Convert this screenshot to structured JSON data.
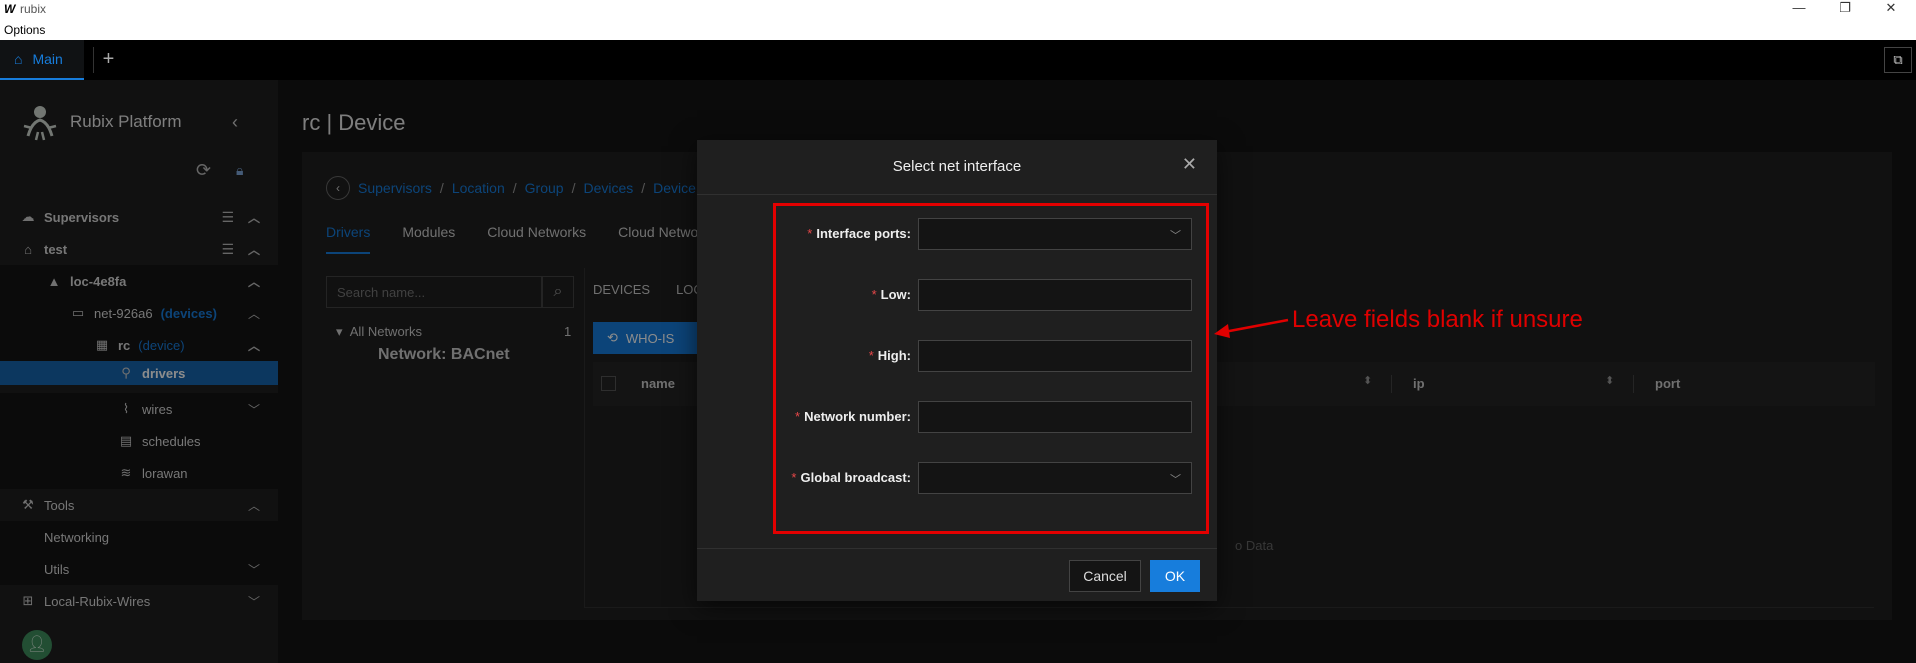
{
  "window": {
    "logo": "W",
    "title": "rubix",
    "minimize": "—",
    "restore": "❐",
    "close": "✕"
  },
  "menu": {
    "options": "Options"
  },
  "tabs": {
    "main": "Main",
    "add": "+",
    "layout_icon": "⧉"
  },
  "sidebar": {
    "brand": "Rubix Platform",
    "items": [
      {
        "label": "Supervisors",
        "icon": "☁"
      },
      {
        "label": "test",
        "icon": "⌂"
      },
      {
        "label": "loc-4e8fa",
        "icon": "▲"
      },
      {
        "label": "net-926a6",
        "tag": "(devices)",
        "icon": "▭"
      },
      {
        "label": "rc",
        "tag": "(device)",
        "icon": "▦"
      },
      {
        "label": "drivers",
        "icon": "⚲"
      },
      {
        "label": "wires",
        "icon": "⌇"
      },
      {
        "label": "schedules",
        "icon": "▤"
      },
      {
        "label": "lorawan",
        "icon": "≋"
      },
      {
        "label": "Tools",
        "icon": "⚒"
      },
      {
        "label": "Networking"
      },
      {
        "label": "Utils"
      },
      {
        "label": "Local-Rubix-Wires",
        "icon": "⊞"
      }
    ]
  },
  "page": {
    "title": "rc | Device",
    "breadcrumb": [
      "Supervisors",
      "Location",
      "Group",
      "Devices",
      "Device"
    ],
    "tabs": [
      "Drivers",
      "Modules",
      "Cloud Networks",
      "Cloud Netwo"
    ],
    "search_placeholder": "Search name...",
    "tree_all": "All Networks",
    "tree_count": "1",
    "tree_network": "Network: BACnet",
    "device_tabs": [
      "DEVICES",
      "LOC"
    ],
    "whois": "WHO-IS",
    "columns": [
      "name",
      "ip",
      "port"
    ],
    "nodata": "o Data"
  },
  "modal": {
    "title": "Select net interface",
    "fields": [
      {
        "label": "Interface ports:",
        "type": "select",
        "value": ""
      },
      {
        "label": "Low:",
        "type": "input",
        "value": ""
      },
      {
        "label": "High:",
        "type": "input",
        "value": ""
      },
      {
        "label": "Network number:",
        "type": "input",
        "value": ""
      },
      {
        "label": "Global broadcast:",
        "type": "select",
        "value": ""
      }
    ],
    "cancel": "Cancel",
    "ok": "OK"
  },
  "annotation": {
    "text": "Leave fields blank if unsure",
    "color": "#e30000"
  }
}
